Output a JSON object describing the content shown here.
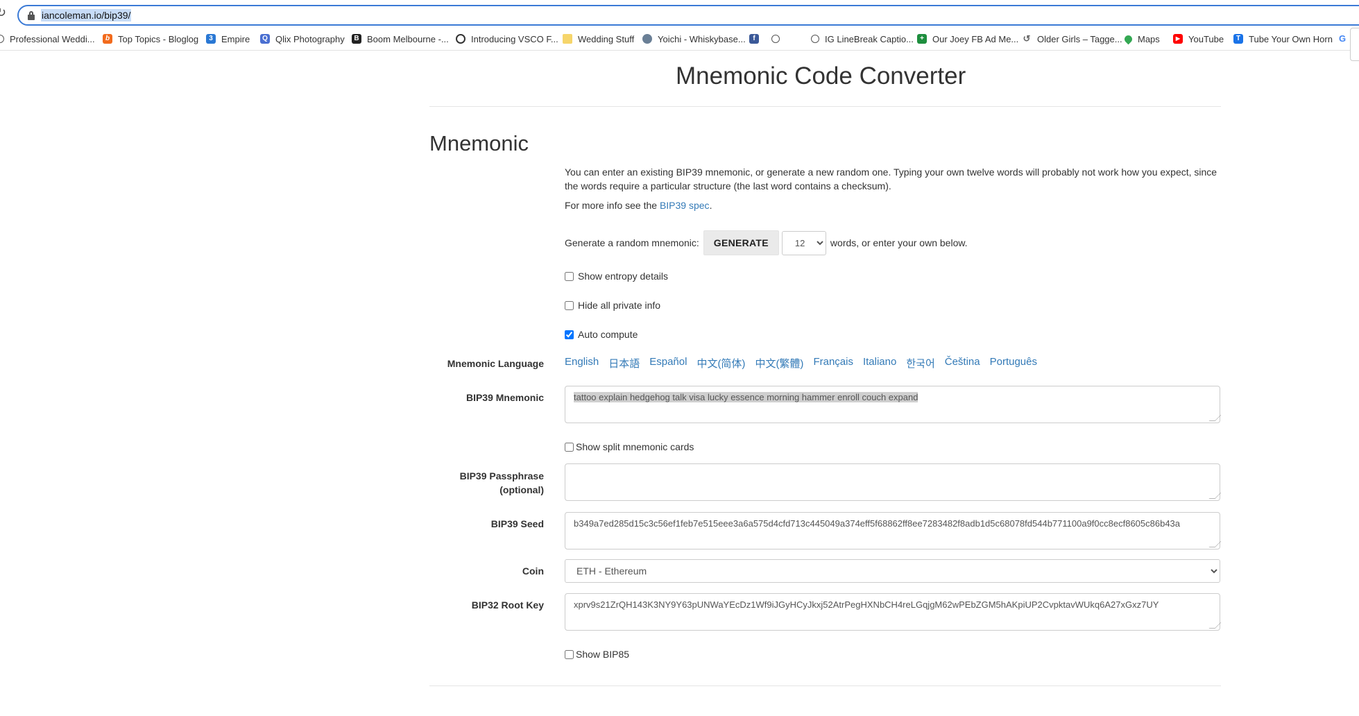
{
  "browser": {
    "url": "iancoleman.io/bip39/",
    "bookmarks": [
      {
        "label": "Professional Weddi...",
        "icon": "globe-icon"
      },
      {
        "label": "Top Topics - Bloglog",
        "icon": "bloglog-icon"
      },
      {
        "label": "Empire",
        "icon": "empire-icon"
      },
      {
        "label": "Qlix Photography",
        "icon": "qlix-icon"
      },
      {
        "label": "Boom Melbourne -...",
        "icon": "boom-icon"
      },
      {
        "label": "Introducing VSCO F...",
        "icon": "vsco-icon"
      },
      {
        "label": "Wedding Stuff",
        "icon": "folder-icon"
      },
      {
        "label": "Yoichi - Whiskybase...",
        "icon": "whiskybase-icon"
      },
      {
        "label": "",
        "icon": "facebook-icon"
      },
      {
        "label": "",
        "icon": "globe-icon"
      },
      {
        "label": "IG LineBreak Captio...",
        "icon": "globe-icon"
      },
      {
        "label": "Our Joey FB Ad Me...",
        "icon": "sheets-icon"
      },
      {
        "label": "Older Girls – Tagge...",
        "icon": "swirl-icon"
      },
      {
        "label": "Maps",
        "icon": "maps-icon"
      },
      {
        "label": "YouTube",
        "icon": "youtube-icon"
      },
      {
        "label": "Tube Your Own Horn",
        "icon": "tube-icon"
      },
      {
        "label": "",
        "icon": "google-icon"
      }
    ]
  },
  "page": {
    "title": "Mnemonic Code Converter",
    "section_title": "Mnemonic",
    "intro": "You can enter an existing BIP39 mnemonic, or generate a new random one. Typing your own twelve words will probably not work how you expect, since the words require a particular structure (the last word contains a checksum).",
    "more_info_prefix": "For more info see the ",
    "more_info_link": "BIP39 spec",
    "more_info_suffix": ".",
    "generate": {
      "prefix": "Generate a random mnemonic:",
      "button": "GENERATE",
      "word_count": "12",
      "suffix": "words, or enter your own below."
    },
    "options": {
      "show_entropy": "Show entropy details",
      "hide_private": "Hide all private info",
      "auto_compute": "Auto compute"
    },
    "language_label": "Mnemonic Language",
    "languages": [
      "English",
      "日本語",
      "Español",
      "中文(简体)",
      "中文(繁體)",
      "Français",
      "Italiano",
      "한국어",
      "Čeština",
      "Português"
    ],
    "mnemonic_label": "BIP39 Mnemonic",
    "mnemonic_value": "tattoo explain hedgehog talk visa lucky essence morning hammer enroll couch expand",
    "split_cards": "Show split mnemonic cards",
    "passphrase_label": "BIP39 Passphrase (optional)",
    "passphrase_value": "",
    "seed_label": "BIP39 Seed",
    "seed_value": "b349a7ed285d15c3c56ef1feb7e515eee3a6a575d4cfd713c445049a374eff5f68862ff8ee7283482f8adb1d5c68078fd544b771100a9f0cc8ecf8605c86b43a",
    "coin_label": "Coin",
    "coin_value": "ETH - Ethereum",
    "root_key_label": "BIP32 Root Key",
    "root_key_value": "xprv9s21ZrQH143K3NY9Y63pUNWaYEcDz1Wf9iJGyHCyJkxj52AtrPegHXNbCH4reLGqjgM62wPEbZGM5hAKpiUP2CvpktavWUkq6A27xGxz7UY",
    "show_bip85": "Show BIP85"
  }
}
